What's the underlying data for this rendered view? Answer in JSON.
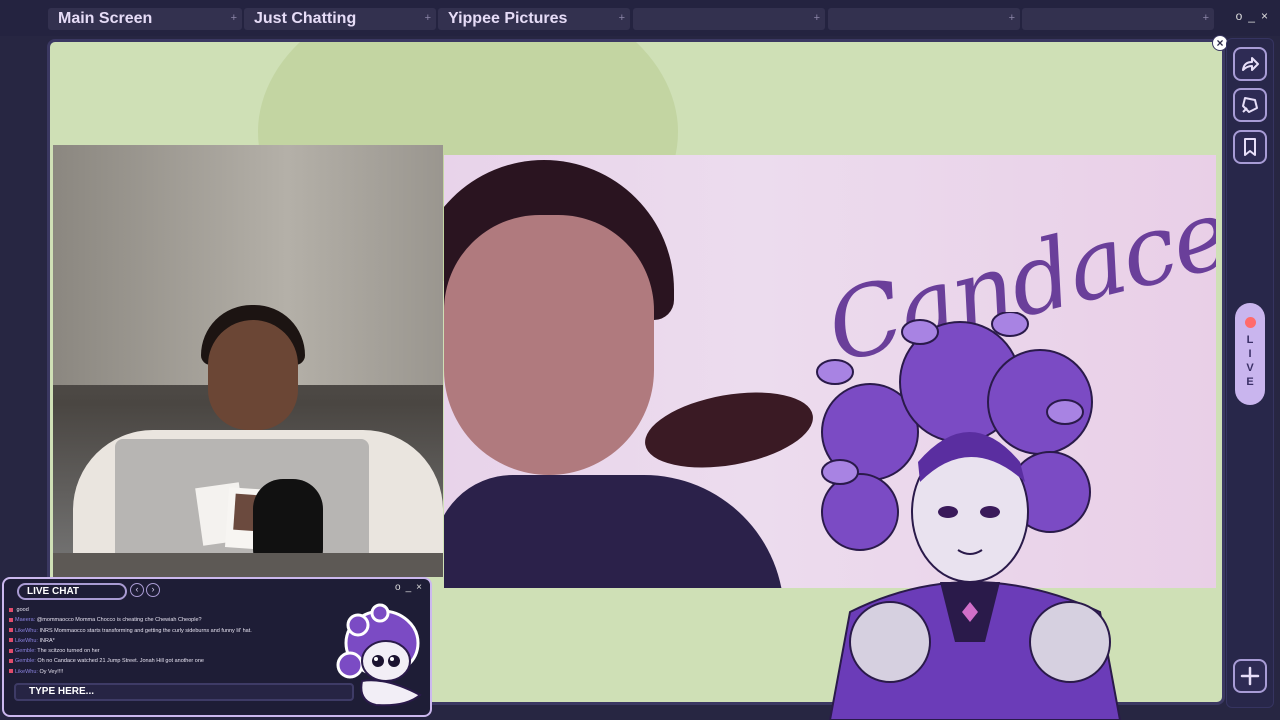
{
  "tabs": [
    {
      "label": "Main Screen"
    },
    {
      "label": "Just Chatting"
    },
    {
      "label": "Yippee Pictures"
    },
    {
      "label": ""
    },
    {
      "label": ""
    },
    {
      "label": ""
    }
  ],
  "tab_add_glyph": "+",
  "window_controls": {
    "restore": "o",
    "minimize": "_",
    "close": "×"
  },
  "stage": {
    "close_glyph": "×",
    "poster_signature": "Candace"
  },
  "rail": {
    "share_icon": "share-arrow-icon",
    "pin_icon": "pin-icon",
    "bookmark_icon": "bookmark-icon",
    "add_icon": "plus-icon",
    "live_label": "LIVE",
    "live_dot_color": "#ff6b6b"
  },
  "chat": {
    "title": "LIVE CHAT",
    "prev": "‹",
    "next": "›",
    "controls": {
      "restore": "o",
      "minimize": "_",
      "close": "×"
    },
    "messages": [
      {
        "user": "",
        "text": "good"
      },
      {
        "user": "Maeera:",
        "text": "@mommaocco Momma Chocco is cheating che Chewiah Cheople?"
      },
      {
        "user": "LikeWhu:",
        "text": "INRS Mommaocco starts transforming and getting the curly sideburns and funny lil' hat."
      },
      {
        "user": "LikeWhu:",
        "text": "INRA*"
      },
      {
        "user": "Gemble:",
        "text": "The scitzoo turned on her"
      },
      {
        "user": "Gemble:",
        "text": "Oh no Candace watched 21 Jump Street. Jonah Hill got another one"
      },
      {
        "user": "LikeWhu:",
        "text": "Oy Vey!!!!"
      }
    ],
    "input_placeholder": "TYPE HERE..."
  },
  "colors": {
    "background": "#272642",
    "stage_bg": "#cfe0b6",
    "accent": "#a89cd6",
    "live_pill": "#c9b5ee"
  }
}
